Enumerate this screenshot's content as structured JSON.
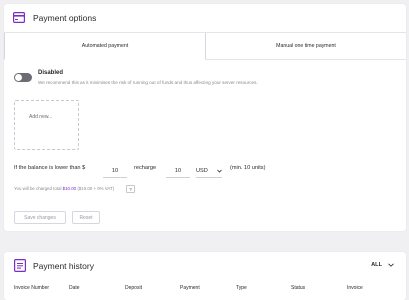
{
  "options": {
    "title": "Payment options",
    "tabs": [
      {
        "label": "Automated payment",
        "active": true
      },
      {
        "label": "Manual one time payment",
        "active": false
      }
    ],
    "disabled_title": "Disabled",
    "disabled_desc": "We recommend this as it minimises the risk of running out of funds and thus affecting your server resources.",
    "add_new": "Add new...",
    "threshold_label": "If the balance is lower than $",
    "threshold_value": "10",
    "recharge_label": "recharge",
    "recharge_value": "10",
    "currency": "USD",
    "min_units": "(min. 10 units)",
    "charged_prefix": "You will be charged total",
    "charged_amount": "$10.00",
    "charged_suffix": "($10.00 + 0% VAT)",
    "help_glyph": "?",
    "save_label": "Save changes",
    "reset_label": "Reset"
  },
  "history": {
    "title": "Payment history",
    "filter": "ALL",
    "columns": [
      "Invoice Number",
      "Date",
      "Deposit",
      "Payment",
      "Type",
      "Status",
      "Invoice"
    ]
  },
  "colors": {
    "accent": "#7a2ec4",
    "toggle_off": "#6c6c74"
  }
}
